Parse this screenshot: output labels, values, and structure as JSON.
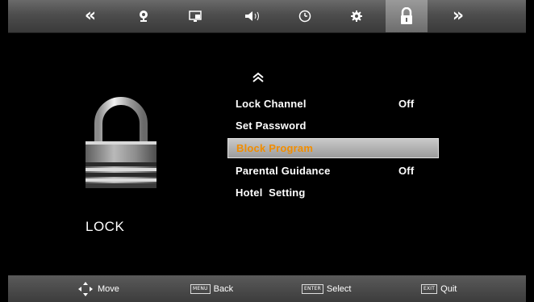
{
  "top_tabs": [
    {
      "id": "prev",
      "icon": "double-chevron-left-icon",
      "glyph": "«"
    },
    {
      "id": "channel",
      "icon": "satellite-dish-icon"
    },
    {
      "id": "picture",
      "icon": "picture-icon"
    },
    {
      "id": "sound",
      "icon": "speaker-icon"
    },
    {
      "id": "time",
      "icon": "clock-icon"
    },
    {
      "id": "setup",
      "icon": "gear-icon"
    },
    {
      "id": "lock",
      "icon": "padlock-icon",
      "active": true
    },
    {
      "id": "next",
      "icon": "double-chevron-right-icon",
      "glyph": "»"
    }
  ],
  "section": {
    "title": "LOCK",
    "icon": "large-padlock-icon"
  },
  "scroll": {
    "up_glyph": "˄˄",
    "down_glyph": "˅˅"
  },
  "menu": {
    "items": [
      {
        "label": "Lock Channel",
        "value": "Off"
      },
      {
        "label": "Set Password",
        "value": ""
      },
      {
        "label": "Block Program",
        "value": "",
        "selected": true
      },
      {
        "label": "Parental Guidance",
        "value": "Off"
      },
      {
        "label": "Hotel  Setting",
        "value": ""
      }
    ]
  },
  "hints": {
    "move": {
      "label": "Move",
      "icon": "dpad-icon"
    },
    "menu": {
      "key": "MENU",
      "label": "Back"
    },
    "enter": {
      "key": "ENTER",
      "label": "Select"
    },
    "exit": {
      "key": "EXIT",
      "label": "Quit"
    }
  },
  "colors": {
    "selected_text": "#f18d00",
    "highlight": "#b5b5b5",
    "bar": "#4d4d4d"
  }
}
